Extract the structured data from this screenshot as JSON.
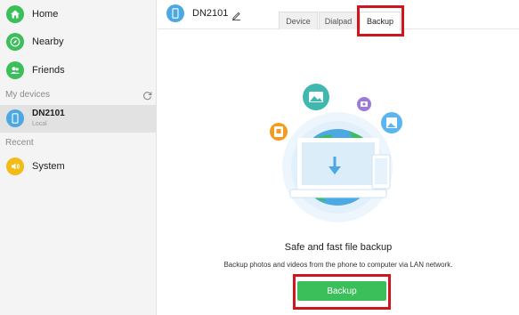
{
  "sidebar": {
    "nav": [
      {
        "label": "Home",
        "icon": "home-icon",
        "color": "#3bbf5a"
      },
      {
        "label": "Nearby",
        "icon": "compass-icon",
        "color": "#3bbf5a"
      },
      {
        "label": "Friends",
        "icon": "friends-icon",
        "color": "#3bbf5a"
      }
    ],
    "my_devices_label": "My devices",
    "device": {
      "name": "DN2101",
      "sub": "Local",
      "icon": "phone-icon",
      "color": "#4ba8e3"
    },
    "recent_label": "Recent",
    "recent": [
      {
        "label": "System",
        "icon": "speaker-icon",
        "color": "#f2bb16"
      }
    ]
  },
  "header": {
    "title": "DN2101",
    "tabs": [
      {
        "label": "Device",
        "active": false
      },
      {
        "label": "Dialpad",
        "active": false
      },
      {
        "label": "Backup",
        "active": true
      }
    ]
  },
  "main": {
    "headline": "Safe and fast file backup",
    "subline": "Backup photos and videos from the phone to computer via LAN network.",
    "button_label": "Backup"
  },
  "colors": {
    "accent_green": "#3bbf5a",
    "accent_blue": "#4ba8e3",
    "highlight_red": "#d0161d"
  }
}
